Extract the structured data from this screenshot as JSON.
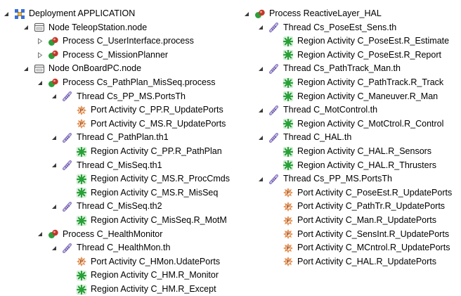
{
  "colors": {
    "selected_text": "#000000",
    "node_border": "#666666",
    "process_red": "#c0392b",
    "process_green": "#2e9e3a",
    "thread_purple": "#8e7cc3",
    "region_green": "#27a037",
    "port_orange": "#e38b4a"
  },
  "tree": {
    "left_column": [
      {
        "label": "Deployment APPLICATION",
        "icon": "deployment-icon",
        "toggle": "expanded"
      },
      {
        "label": "Node TeleopStation.node",
        "icon": "node-icon",
        "toggle": "expanded"
      },
      {
        "label": "Process C_UserInterface.process",
        "icon": "process-icon",
        "toggle": "collapsed"
      },
      {
        "label": "Process C_MissionPlanner",
        "icon": "process-icon",
        "toggle": "collapsed"
      },
      {
        "label": "Node OnBoardPC.node",
        "icon": "node-icon",
        "toggle": "expanded"
      },
      {
        "label": "Process Cs_PathPlan_MisSeq.process",
        "icon": "process-icon",
        "toggle": "expanded"
      },
      {
        "label": "Thread Cs_PP_MS.PortsTh",
        "icon": "thread-icon",
        "toggle": "expanded"
      },
      {
        "label": "Port Activity C_PP.R_UpdatePorts",
        "icon": "port-icon",
        "toggle": "none"
      },
      {
        "label": "Port Activity C_MS.R_UpdatePorts",
        "icon": "port-icon",
        "toggle": "none"
      },
      {
        "label": "Thread C_PathPlan.th1",
        "icon": "thread-icon",
        "toggle": "expanded"
      },
      {
        "label": "Region Activity C_PP.R_PathPlan",
        "icon": "region-icon",
        "toggle": "none"
      },
      {
        "label": "Thread C_MisSeq.th1",
        "icon": "thread-icon",
        "toggle": "expanded"
      },
      {
        "label": "Region Activity C_MS.R_ProcCmds",
        "icon": "region-icon",
        "toggle": "none"
      },
      {
        "label": "Region Activity C_MS.R_MisSeq",
        "icon": "region-icon",
        "toggle": "none"
      },
      {
        "label": "Thread C_MisSeq.th2",
        "icon": "thread-icon",
        "toggle": "expanded"
      },
      {
        "label": "Region Activity C_MisSeq.R_MotM",
        "icon": "region-icon",
        "toggle": "none"
      },
      {
        "label": "Process C_HealthMonitor",
        "icon": "process-icon",
        "toggle": "expanded"
      },
      {
        "label": "Thread C_HealthMon.th",
        "icon": "thread-icon",
        "toggle": "expanded"
      },
      {
        "label": "Port Activity C_HMon.UdatePorts",
        "icon": "port-icon",
        "toggle": "none"
      },
      {
        "label": "Region Activity C_HM.R_Monitor",
        "icon": "region-icon",
        "toggle": "none"
      },
      {
        "label": "Region Activity C_HM.R_Except",
        "icon": "region-icon",
        "toggle": "none"
      }
    ],
    "right_column": [
      {
        "label": "Process ReactiveLayer_HAL",
        "icon": "process-icon",
        "toggle": "expanded"
      },
      {
        "label": "Thread Cs_PoseEst_Sens.th",
        "icon": "thread-icon",
        "toggle": "expanded"
      },
      {
        "label": "Region Activity C_PoseEst.R_Estimate",
        "icon": "region-icon",
        "toggle": "none"
      },
      {
        "label": "Region Activity C_PoseEst.R_Report",
        "icon": "region-icon",
        "toggle": "none"
      },
      {
        "label": "Thread Cs_PathTrack_Man.th",
        "icon": "thread-icon",
        "toggle": "expanded"
      },
      {
        "label": "Region Activity C_PathTrack.R_Track",
        "icon": "region-icon",
        "toggle": "none"
      },
      {
        "label": "Region Activity C_Maneuver.R_Man",
        "icon": "region-icon",
        "toggle": "none"
      },
      {
        "label": "Thread C_MotControl.th",
        "icon": "thread-icon",
        "toggle": "expanded"
      },
      {
        "label": "Region Activity C_MotCtrol.R_Control",
        "icon": "region-icon",
        "toggle": "none"
      },
      {
        "label": "Thread C_HAL.th",
        "icon": "thread-icon",
        "toggle": "expanded"
      },
      {
        "label": "Region Activity C_HAL.R_Sensors",
        "icon": "region-icon",
        "toggle": "none"
      },
      {
        "label": "Region Activity C_HAL.R_Thrusters",
        "icon": "region-icon",
        "toggle": "none"
      },
      {
        "label": "Thread Cs_PP_MS.PortsTh",
        "icon": "thread-icon",
        "toggle": "expanded"
      },
      {
        "label": "Port Activity C_PoseEst.R_UpdatePorts",
        "icon": "port-icon",
        "toggle": "none"
      },
      {
        "label": "Port Activity C_PathTr.R_UpdatePorts",
        "icon": "port-icon",
        "toggle": "none"
      },
      {
        "label": "Port Activity C_Man.R_UpdatePorts",
        "icon": "port-icon",
        "toggle": "none"
      },
      {
        "label": "Port Activity C_SensInt.R_UpdatePorts",
        "icon": "port-icon",
        "toggle": "none"
      },
      {
        "label": "Port Activity C_MCntrol.R_UpdatePorts",
        "icon": "port-icon",
        "toggle": "none"
      },
      {
        "label": "Port Activity C_HAL.R_UpdatePorts",
        "icon": "port-icon",
        "toggle": "none"
      }
    ]
  }
}
